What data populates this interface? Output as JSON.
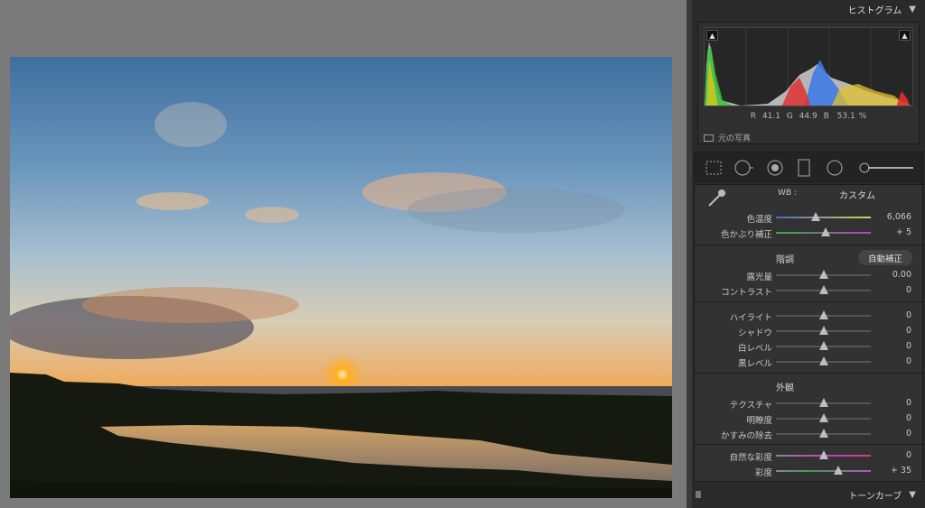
{
  "histogram_panel": {
    "title": "ヒストグラム",
    "collapse_icon": "triangle-down-icon",
    "readout": {
      "r_label": "R",
      "r_value": "41.1",
      "g_label": "G",
      "g_value": "44.9",
      "b_label": "B",
      "b_value": "53.1",
      "unit": "%"
    },
    "original_photo_label": "元の写真"
  },
  "basic": {
    "wb_label": "WB :",
    "wb_value": "カスタム",
    "temp": {
      "label": "色温度",
      "value": "6,066",
      "level": 0.42
    },
    "tint": {
      "label": "色かぶり補正",
      "value": "+ 5",
      "level": 0.52
    },
    "tone_title": "階調",
    "auto_button": "自動補正",
    "exposure": {
      "label": "露光量",
      "value": "0.00",
      "level": 0.5
    },
    "contrast": {
      "label": "コントラスト",
      "value": "0",
      "level": 0.5
    },
    "highlights": {
      "label": "ハイライト",
      "value": "0",
      "level": 0.5
    },
    "shadows": {
      "label": "シャドウ",
      "value": "0",
      "level": 0.5
    },
    "whites": {
      "label": "白レベル",
      "value": "0",
      "level": 0.5
    },
    "blacks": {
      "label": "黒レベル",
      "value": "0",
      "level": 0.5
    },
    "presence_title": "外観",
    "texture": {
      "label": "テクスチャ",
      "value": "0",
      "level": 0.5
    },
    "clarity": {
      "label": "明瞭度",
      "value": "0",
      "level": 0.5
    },
    "dehaze": {
      "label": "かすみの除去",
      "value": "0",
      "level": 0.5
    },
    "vibrance": {
      "label": "自然な彩度",
      "value": "0",
      "level": 0.5
    },
    "saturation": {
      "label": "彩度",
      "value": "+ 35",
      "level": 0.66
    }
  },
  "tone_curve_panel": {
    "title": "トーンカーブ"
  }
}
